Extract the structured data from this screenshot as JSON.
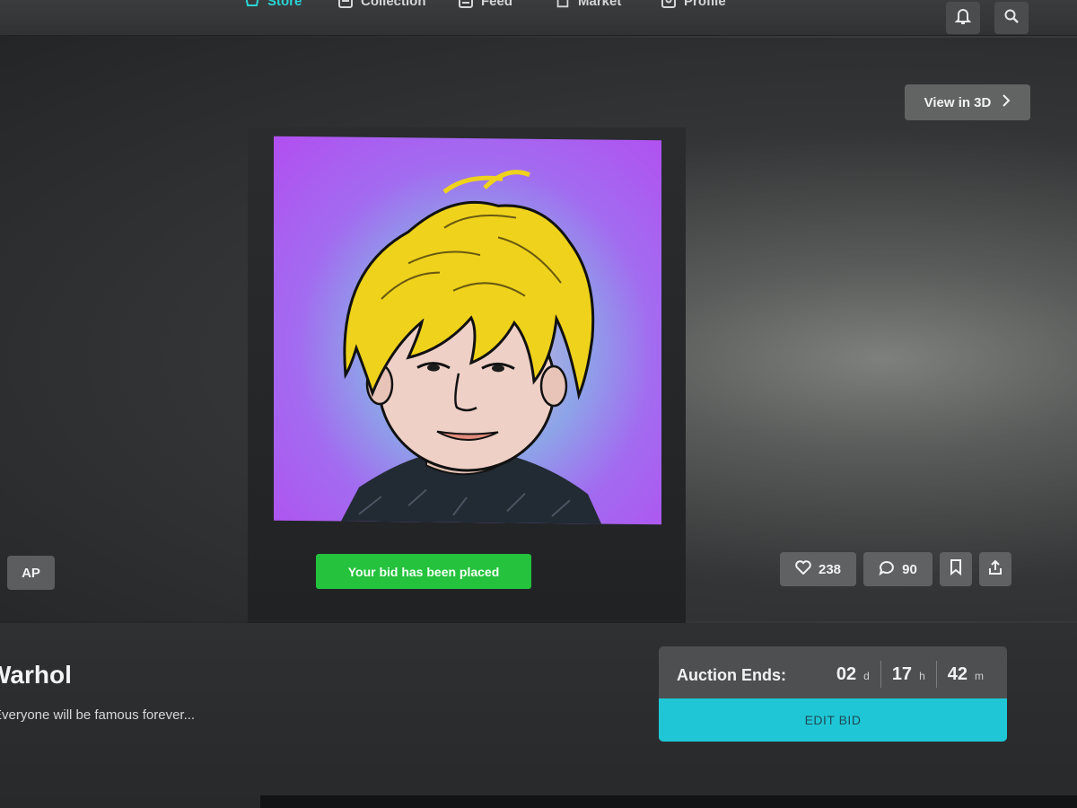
{
  "nav": {
    "items": [
      {
        "label": "Store",
        "icon": "store-icon"
      },
      {
        "label": "Collection",
        "icon": "collection-icon"
      },
      {
        "label": "Feed",
        "icon": "feed-icon"
      },
      {
        "label": "Market",
        "icon": "market-icon"
      },
      {
        "label": "Profile",
        "icon": "profile-icon"
      }
    ],
    "accent": "#2bd4d4"
  },
  "hero": {
    "view3d_label": "View in 3D",
    "creator_initials": "AP",
    "toast": "Your bid has been placed",
    "toast_color": "#25c23e",
    "likes": "238",
    "comments": "90"
  },
  "artwork": {
    "title": "Warhol",
    "description": "Everyone will be famous forever..."
  },
  "auction": {
    "label": "Auction Ends:",
    "days": "02",
    "days_unit": "d",
    "hours": "17",
    "hours_unit": "h",
    "minutes": "42",
    "minutes_unit": "m",
    "edit_bid_label": "EDIT BID",
    "button_color": "#1fc7d6"
  }
}
